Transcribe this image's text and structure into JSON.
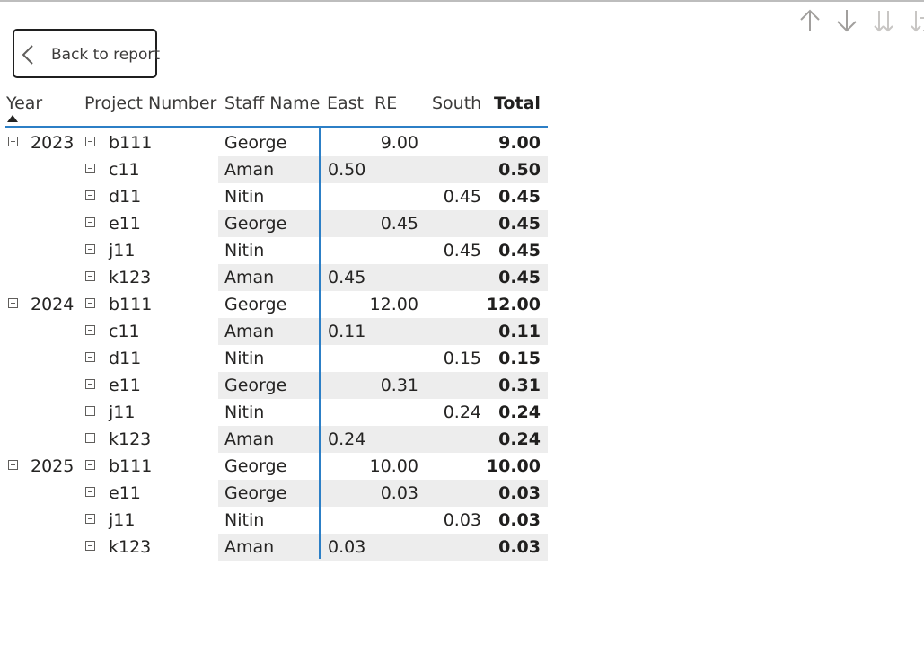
{
  "toolbar": {
    "icons": [
      "arrow-up-icon",
      "arrow-down-icon",
      "double-arrow-down-icon",
      "expand-hierarchy-icon"
    ]
  },
  "back_button": {
    "label": "Back to report"
  },
  "matrix": {
    "headers": {
      "year": "Year",
      "project_number": "Project Number",
      "staff_name": "Staff Name",
      "east": "East",
      "re": "RE",
      "south": "South",
      "total": "Total"
    },
    "accent_color": "#2c7fc6",
    "rows": [
      {
        "year": "2023",
        "project": "b111",
        "staff": "George",
        "east": "",
        "re": "9.00",
        "south": "",
        "total": "9.00"
      },
      {
        "year": "",
        "project": "c11",
        "staff": "Aman",
        "east": "0.50",
        "re": "",
        "south": "",
        "total": "0.50"
      },
      {
        "year": "",
        "project": "d11",
        "staff": "Nitin",
        "east": "",
        "re": "",
        "south": "0.45",
        "total": "0.45"
      },
      {
        "year": "",
        "project": "e11",
        "staff": "George",
        "east": "",
        "re": "0.45",
        "south": "",
        "total": "0.45"
      },
      {
        "year": "",
        "project": "j11",
        "staff": "Nitin",
        "east": "",
        "re": "",
        "south": "0.45",
        "total": "0.45"
      },
      {
        "year": "",
        "project": "k123",
        "staff": "Aman",
        "east": "0.45",
        "re": "",
        "south": "",
        "total": "0.45"
      },
      {
        "year": "2024",
        "project": "b111",
        "staff": "George",
        "east": "",
        "re": "12.00",
        "south": "",
        "total": "12.00"
      },
      {
        "year": "",
        "project": "c11",
        "staff": "Aman",
        "east": "0.11",
        "re": "",
        "south": "",
        "total": "0.11"
      },
      {
        "year": "",
        "project": "d11",
        "staff": "Nitin",
        "east": "",
        "re": "",
        "south": "0.15",
        "total": "0.15"
      },
      {
        "year": "",
        "project": "e11",
        "staff": "George",
        "east": "",
        "re": "0.31",
        "south": "",
        "total": "0.31"
      },
      {
        "year": "",
        "project": "j11",
        "staff": "Nitin",
        "east": "",
        "re": "",
        "south": "0.24",
        "total": "0.24"
      },
      {
        "year": "",
        "project": "k123",
        "staff": "Aman",
        "east": "0.24",
        "re": "",
        "south": "",
        "total": "0.24"
      },
      {
        "year": "2025",
        "project": "b111",
        "staff": "George",
        "east": "",
        "re": "10.00",
        "south": "",
        "total": "10.00"
      },
      {
        "year": "",
        "project": "e11",
        "staff": "George",
        "east": "",
        "re": "0.03",
        "south": "",
        "total": "0.03"
      },
      {
        "year": "",
        "project": "j11",
        "staff": "Nitin",
        "east": "",
        "re": "",
        "south": "0.03",
        "total": "0.03"
      },
      {
        "year": "",
        "project": "k123",
        "staff": "Aman",
        "east": "0.03",
        "re": "",
        "south": "",
        "total": "0.03"
      }
    ]
  }
}
